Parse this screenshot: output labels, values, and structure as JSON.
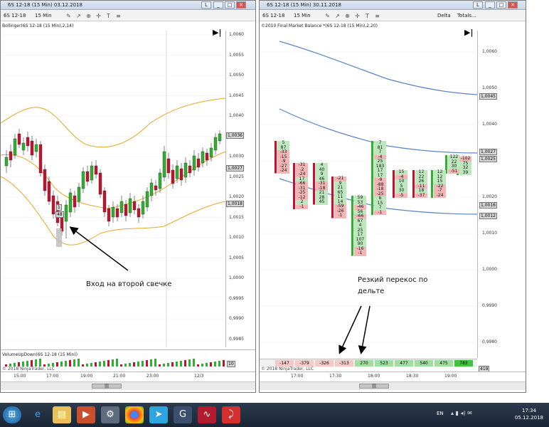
{
  "left_window": {
    "title": "6S 12-18 (15 Min)  03.12.2018",
    "toolbar": {
      "instrument": "6S 12-18",
      "interval": "15 Min"
    },
    "indicator_label": "Bollinger(6S 12-18 (15 Min),2,14)",
    "price_ticks": [
      "1,0060",
      "1,0055",
      "1,0050",
      "1,0045",
      "1,0040",
      "1,0035",
      "1,0030",
      "1,0025",
      "1,0020",
      "1,0015",
      "1,0010",
      "1,0005",
      "1,0000",
      "0,9995",
      "0,9990",
      "0,9985"
    ],
    "price_tags": [
      "1,0036",
      "1,0027",
      "1,0018"
    ],
    "time_ticks": [
      "15:00",
      "17:00",
      "19:00",
      "21:00",
      "23:00",
      "12/3"
    ],
    "volume_label": "VolumeUpDown(6S 12-18 (15 Min))",
    "volume_tag": "10",
    "copyright": "© 2018 NinjaTrader, LLC",
    "annotation": "Вход на второй свечке",
    "candle_tags": [
      "1",
      "48"
    ]
  },
  "right_window": {
    "title": "6S 12-18 (15 Min)  30.11.2018",
    "toolbar": {
      "instrument": "6S 12-18",
      "interval": "15 Min",
      "mode": "Delta",
      "totals": "Totals..."
    },
    "indicator_label": "©2010 Final Market Balance  *(6S 12-18 (15 Min),2,20)",
    "price_ticks": [
      "1,0060",
      "1,0050",
      "1,0040",
      "1,0030",
      "1,0020",
      "1,0010",
      "1,0000",
      "0,9990",
      "0,9980"
    ],
    "price_tags": [
      "1,0045",
      "1,0027",
      "1,0025",
      "1,0016",
      "1,0012"
    ],
    "time_ticks": [
      "17:00",
      "17:30",
      "18:00",
      "18:30",
      "19:00"
    ],
    "deltas": [
      "-147",
      "-379",
      "-326",
      "-313",
      "270",
      "523",
      "477",
      "540",
      "475",
      "783"
    ],
    "delta_tag": "419",
    "copyright": "© 2018 NinjaTrader, LLC",
    "annotation_line1": "Резкий перекос по",
    "annotation_line2": "дельте",
    "footprint": {
      "col1": [
        "5",
        "87",
        "-33",
        "-15",
        "-9",
        "-27",
        "-24"
      ],
      "col2": [
        "-31",
        "-2",
        "-24",
        "17",
        "-66",
        "-31",
        "-25",
        "-12",
        "2",
        "-1"
      ],
      "col3": [
        "4",
        "40",
        "9",
        "46",
        "-31",
        "-18",
        "21",
        "28",
        "45"
      ],
      "col4": [
        "-21",
        "9",
        "21",
        "65",
        "11",
        "14",
        "-59",
        "-26",
        "-1"
      ],
      "col5": [
        "59",
        "53",
        "-46",
        "56",
        "-66",
        "67",
        "4",
        "25",
        "17",
        "107",
        "90",
        "-16",
        "-1"
      ],
      "col6": [
        "7",
        "81",
        "7",
        "-4",
        "25",
        "183",
        "17",
        "17",
        "-9",
        "-88",
        "-18",
        "-25",
        "6",
        "15",
        "7",
        "-1"
      ],
      "col7": [
        "15",
        "-4",
        "10",
        "5",
        "30",
        "-5"
      ],
      "col8": [
        "12",
        "22",
        "26",
        "-11",
        "18",
        "-37"
      ],
      "col9": [
        "12",
        "12",
        "15",
        "-22",
        "-7",
        "-24"
      ],
      "col10": [
        "122",
        "22",
        "30",
        "-51"
      ],
      "col11": [
        "-102",
        "75",
        "32",
        "39"
      ]
    }
  },
  "taskbar": {
    "language": "EN",
    "time": "17:34",
    "date": "05.12.2018",
    "apps": [
      "start-icon",
      "ie-icon",
      "explorer-icon",
      "media-icon",
      "settings-icon",
      "chrome-icon",
      "telegram-icon",
      "g-icon",
      "ninja-icon",
      "acrobat-icon"
    ]
  },
  "colors": {
    "bull": "#2db22d",
    "bear": "#c8102e",
    "bollinger": "#e8a728",
    "fmb_line": "#5b84c4",
    "buy_cell": "#bde8bd",
    "sell_cell": "#f3b6b6"
  }
}
